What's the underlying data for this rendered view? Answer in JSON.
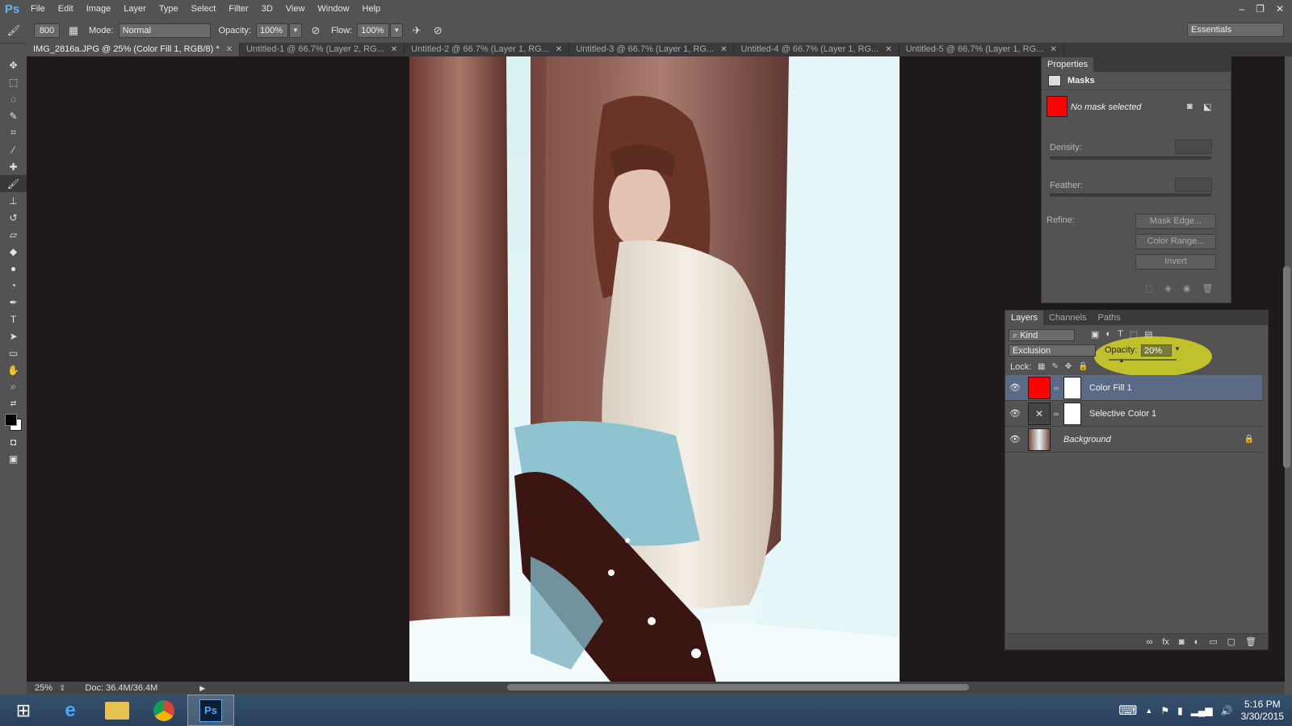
{
  "app": {
    "logo": "Ps"
  },
  "menu": [
    "File",
    "Edit",
    "Image",
    "Layer",
    "Type",
    "Select",
    "Filter",
    "3D",
    "View",
    "Window",
    "Help"
  ],
  "window_controls": [
    "–",
    "❐",
    "✕"
  ],
  "options": {
    "brush_size": "800",
    "mode_label": "Mode:",
    "mode_value": "Normal",
    "opacity_label": "Opacity:",
    "opacity_value": "100%",
    "flow_label": "Flow:",
    "flow_value": "100%",
    "workspace": "Essentials"
  },
  "tabs": [
    {
      "label": "IMG_2816a.JPG @ 25% (Color Fill 1, RGB/8) *",
      "active": true
    },
    {
      "label": "Untitled-1 @ 66.7% (Layer 2, RG...",
      "active": false
    },
    {
      "label": "Untitled-2 @ 66.7% (Layer 1, RG...",
      "active": false
    },
    {
      "label": "Untitled-3 @ 66.7% (Layer 1, RG...",
      "active": false
    },
    {
      "label": "Untitled-4 @ 66.7% (Layer 1, RG...",
      "active": false
    },
    {
      "label": "Untitled-5 @ 66.7% (Layer 1, RG...",
      "active": false
    }
  ],
  "status": {
    "zoom": "25%",
    "doc": "Doc: 36.4M/36.4M"
  },
  "properties": {
    "tab": "Properties",
    "section": "Masks",
    "no_mask": "No mask selected",
    "density_label": "Density:",
    "feather_label": "Feather:",
    "refine_label": "Refine:",
    "btn_mask_edge": "Mask Edge...",
    "btn_color_range": "Color Range...",
    "btn_invert": "Invert"
  },
  "layers_panel": {
    "tabs": [
      "Layers",
      "Channels",
      "Paths"
    ],
    "filter_kind": "Kind",
    "blend_mode": "Exclusion",
    "opacity_label": "Opacity:",
    "opacity_value": "20%",
    "lock_label": "Lock:",
    "layers": [
      {
        "name": "Color Fill 1",
        "selected": true
      },
      {
        "name": "Selective Color 1",
        "selected": false
      },
      {
        "name": "Background",
        "selected": false
      }
    ]
  },
  "taskbar": {
    "time": "5:16 PM",
    "date": "3/30/2015"
  },
  "colors": {
    "accent_fill": "#ff0000",
    "highlight": "#e6e61e",
    "selected_row": "#5a6a85"
  }
}
